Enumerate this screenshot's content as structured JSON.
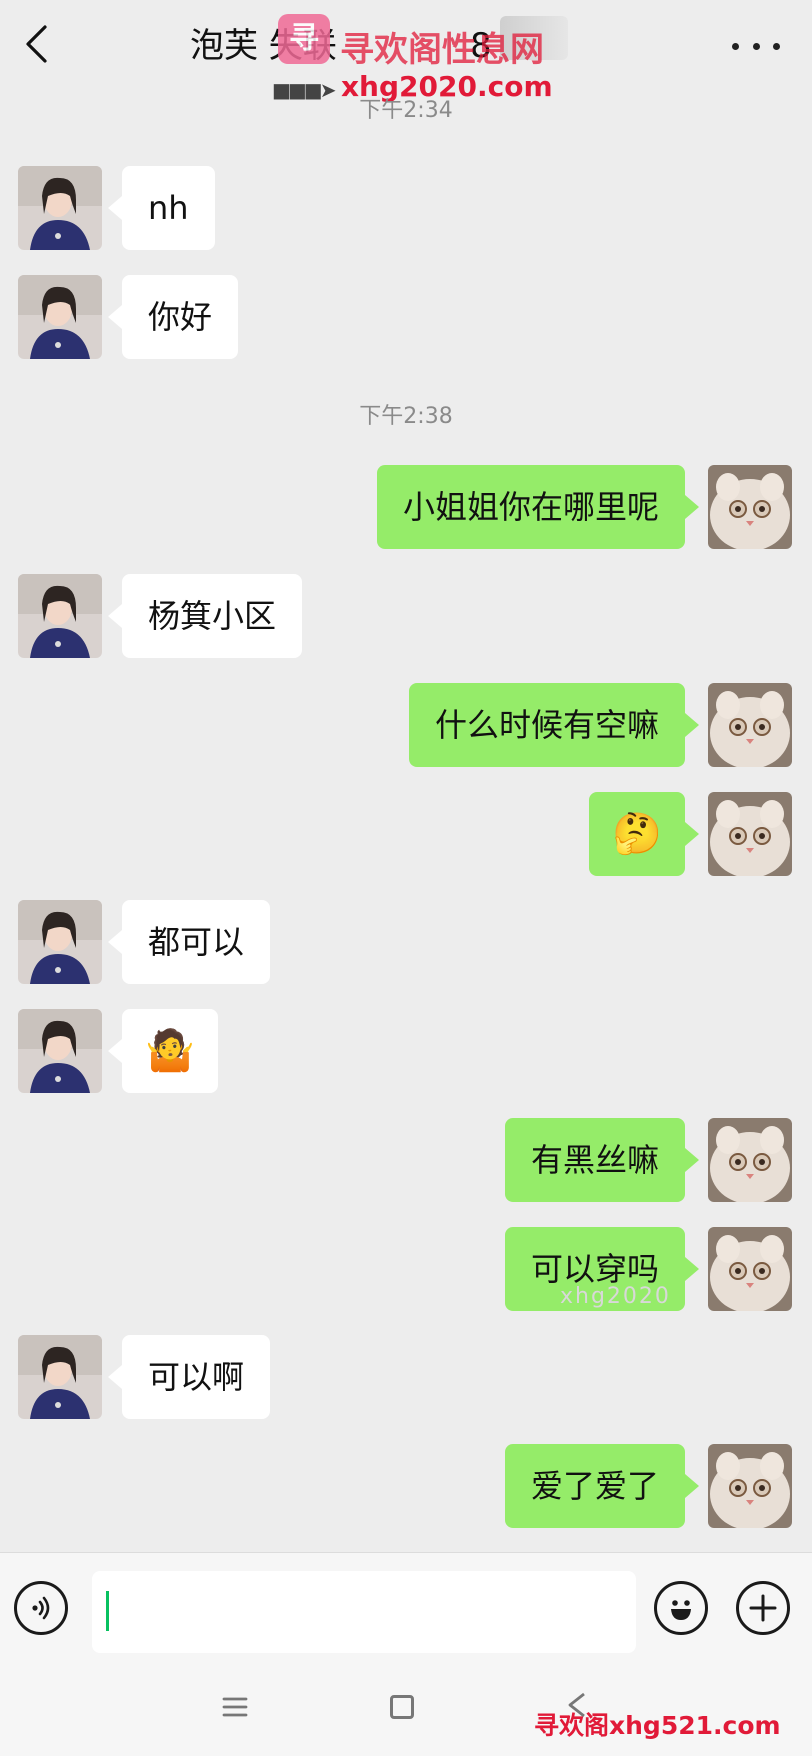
{
  "header": {
    "title_name": "泡芙  失联",
    "title_count": "8",
    "watermark_logo": "寻",
    "watermark_site_name": "寻欢阁性息网",
    "watermark_url": "xhg2020.com"
  },
  "timestamps": [
    "下午2:34",
    "下午2:38"
  ],
  "messages": [
    {
      "side": "in",
      "text": "nh"
    },
    {
      "side": "in",
      "text": "你好"
    },
    {
      "side": "out",
      "text": "小姐姐你在哪里呢"
    },
    {
      "side": "in",
      "text": "杨箕小区"
    },
    {
      "side": "out",
      "text": "什么时候有空嘛"
    },
    {
      "side": "out",
      "emoji": "🤔"
    },
    {
      "side": "in",
      "text": "都可以"
    },
    {
      "side": "in",
      "emoji": "🤷"
    },
    {
      "side": "out",
      "text": "有黑丝嘛"
    },
    {
      "side": "out",
      "text": "可以穿吗"
    },
    {
      "side": "in",
      "text": "可以啊"
    },
    {
      "side": "out",
      "text": "爱了爱了"
    }
  ],
  "input": {
    "value": "",
    "placeholder": ""
  },
  "icons": {
    "back": "chevron-left-icon",
    "more": "more-dots-icon",
    "voice": "voice-icon",
    "emoji": "smiley-icon",
    "plus": "plus-icon",
    "nav_menu": "menu-icon",
    "nav_home": "home-square-icon",
    "nav_back": "back-triangle-icon"
  },
  "colors": {
    "background": "#ededed",
    "outgoing_bubble": "#95ec69",
    "incoming_bubble": "#ffffff",
    "caret": "#07c160",
    "watermark": "#e11a38"
  },
  "watermarks": {
    "bottom": "寻欢阁xhg521.com",
    "middle": "xhg2020"
  }
}
